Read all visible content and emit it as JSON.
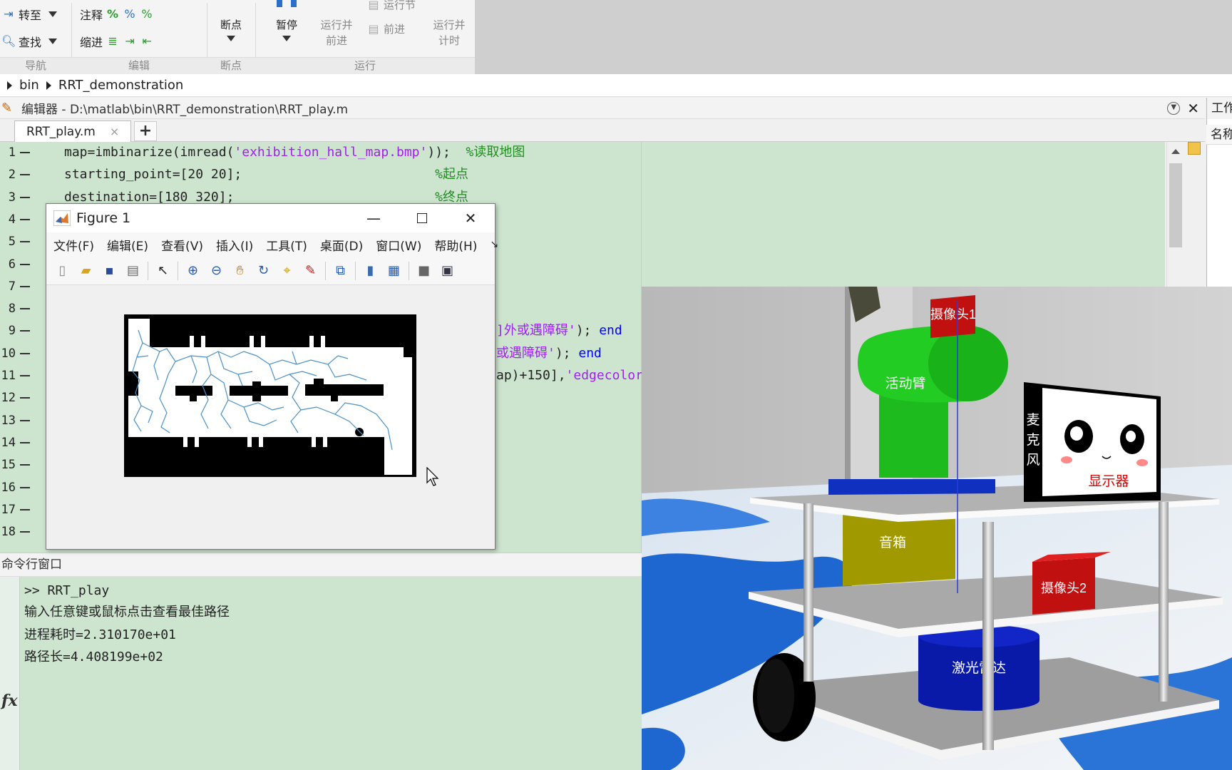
{
  "ribbon": {
    "nav": {
      "goto_label": "转至",
      "find_label": "查找",
      "group_label": "导航"
    },
    "edit": {
      "comment_label": "注释",
      "indent_label": "缩进",
      "group_label": "编辑"
    },
    "breakpoints": {
      "button_label": "断点",
      "group_label": "断点"
    },
    "run": {
      "pause_label": "暂停",
      "run_advance_line1": "运行并",
      "run_advance_line2": "前进",
      "run_section_label": "运行节",
      "advance_label": "前进",
      "run_time_line1": "运行并",
      "run_time_line2": "计时",
      "group_label": "运行"
    }
  },
  "address": {
    "crumbs": [
      "bin",
      "RRT_demonstration"
    ]
  },
  "editor": {
    "title": "编辑器 - D:\\matlab\\bin\\RRT_demonstration\\RRT_play.m",
    "tab_label": "RRT_play.m",
    "tab_close": "×",
    "add_tab": "+",
    "line_numbers": [
      "1",
      "2",
      "3",
      "4",
      "5",
      "6",
      "7",
      "8",
      "9",
      "10",
      "11",
      "12",
      "13",
      "14",
      "15",
      "16",
      "17",
      "18"
    ],
    "lines": [
      {
        "parts": [
          {
            "t": "map=imbinarize(imread(",
            "c": ""
          },
          {
            "t": "'exhibition_hall_map.bmp'",
            "c": "str"
          },
          {
            "t": "));  ",
            "c": ""
          },
          {
            "t": "%读取地图",
            "c": "cmt"
          }
        ]
      },
      {
        "parts": [
          {
            "t": "starting_point=[20 20];                         ",
            "c": ""
          },
          {
            "t": "%起点",
            "c": "cmt"
          }
        ]
      },
      {
        "parts": [
          {
            "t": "destination=[180 320];                          ",
            "c": ""
          },
          {
            "t": "%终点",
            "c": "cmt"
          }
        ]
      }
    ],
    "partial_lines": [
      {
        "parts": [
          {
            "t": "]外或遇障碍'",
            "c": "str"
          },
          {
            "t": "); ",
            "c": ""
          },
          {
            "t": "end",
            "c": "kw"
          }
        ]
      },
      {
        "parts": [
          {
            "t": "或遇障碍'",
            "c": "str"
          },
          {
            "t": "); ",
            "c": ""
          },
          {
            "t": "end",
            "c": "kw"
          }
        ]
      },
      {
        "parts": [
          {
            "t": "ap)+150],",
            "c": ""
          },
          {
            "t": "'edgecolor",
            "c": "str"
          }
        ]
      }
    ]
  },
  "workspace": {
    "title": "工作",
    "column": "名称"
  },
  "command_window": {
    "title": "命令行窗口",
    "lines": [
      ">> RRT_play",
      "输入任意键或鼠标点击查看最佳路径",
      "进程耗时=2.310170e+01",
      "路径长=4.408199e+02"
    ],
    "fx": "fx"
  },
  "figure": {
    "title": "Figure 1",
    "menu": [
      "文件(F)",
      "编辑(E)",
      "查看(V)",
      "插入(I)",
      "工具(T)",
      "桌面(D)",
      "窗口(W)",
      "帮助(H)"
    ],
    "more": "↘",
    "toolbar_icons": [
      "new-figure-icon",
      "open-file-icon",
      "save-icon",
      "print-icon",
      "pointer-icon",
      "zoom-in-icon",
      "zoom-out-icon",
      "pan-icon",
      "rotate-icon",
      "data-cursor-icon",
      "brush-icon",
      "link-icon",
      "colorbar-icon",
      "legend-icon",
      "hide-plot-tools-icon",
      "show-plot-tools-icon"
    ]
  },
  "robot_labels": {
    "camera1": "摄像头1",
    "arm": "活动臂",
    "mic": [
      "麦",
      "克",
      "风"
    ],
    "display": "显示器",
    "speaker": "音箱",
    "camera2": "摄像头2",
    "lidar": "激光雷达"
  },
  "colors": {
    "editor_bg": "#cde5cf",
    "string": "#a020f0",
    "comment": "#228b22",
    "keyword": "#0000ff",
    "arm": "#22cc22",
    "base": "#1030c0",
    "speaker": "#a8a000",
    "camera": "#d81818",
    "lidar": "#0a1aa8"
  }
}
